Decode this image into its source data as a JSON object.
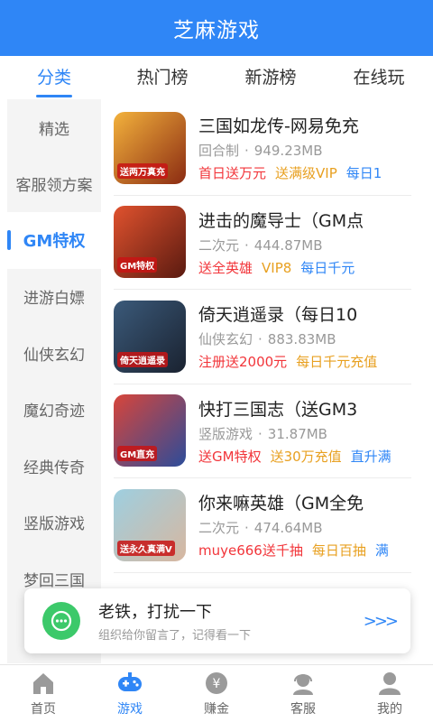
{
  "header": {
    "title": "芝麻游戏"
  },
  "tabs": [
    {
      "label": "分类",
      "active": true
    },
    {
      "label": "热门榜",
      "active": false
    },
    {
      "label": "新游榜",
      "active": false
    },
    {
      "label": "在线玩",
      "active": false
    }
  ],
  "sidebar": {
    "items": [
      {
        "label": "精选"
      },
      {
        "label": "客服领方案"
      },
      {
        "label": "GM特权",
        "active": true
      },
      {
        "label": "进游白嫖"
      },
      {
        "label": "仙侠玄幻"
      },
      {
        "label": "魔幻奇迹"
      },
      {
        "label": "经典传奇"
      },
      {
        "label": "竖版游戏"
      },
      {
        "label": "梦回三国"
      },
      {
        "label": ""
      }
    ]
  },
  "games": [
    {
      "name": "三国如龙传-网易免充",
      "type": "回合制",
      "size": "949.23MB",
      "icon_text": "送两万真充",
      "icon_colors": [
        "#f3b23c",
        "#8b2b12"
      ],
      "tags": [
        {
          "text": "首日送万元",
          "color": "red"
        },
        {
          "text": "送满级VIP",
          "color": "gold"
        },
        {
          "text": "每日1",
          "color": "blue"
        }
      ]
    },
    {
      "name": "进击的魔导士（GM点",
      "type": "二次元",
      "size": "444.87MB",
      "icon_text": "GM特权",
      "icon_colors": [
        "#e0522e",
        "#5a1a10"
      ],
      "tags": [
        {
          "text": "送全英雄",
          "color": "red"
        },
        {
          "text": "VIP8",
          "color": "gold"
        },
        {
          "text": "每日千元",
          "color": "blue"
        }
      ]
    },
    {
      "name": "倚天逍遥录（每日10",
      "type": "仙侠玄幻",
      "size": "883.83MB",
      "icon_text": "倚天逍遥录",
      "icon_colors": [
        "#3b5a7a",
        "#1a2230"
      ],
      "tags": [
        {
          "text": "注册送2000元",
          "color": "red"
        },
        {
          "text": "每日千元充值",
          "color": "gold"
        }
      ]
    },
    {
      "name": "快打三国志（送GM3",
      "type": "竖版游戏",
      "size": "31.87MB",
      "icon_text": "GM直充",
      "icon_colors": [
        "#d8453a",
        "#2c4c9a"
      ],
      "tags": [
        {
          "text": "送GM特权",
          "color": "red"
        },
        {
          "text": "送30万充值",
          "color": "gold"
        },
        {
          "text": "直升满",
          "color": "blue"
        }
      ]
    },
    {
      "name": "你来嘛英雄（GM全免",
      "type": "二次元",
      "size": "474.64MB",
      "icon_text": "送永久真满V",
      "icon_colors": [
        "#9ecfe0",
        "#d7b7a0"
      ],
      "tags": [
        {
          "text": "muye666送千抽",
          "color": "red"
        },
        {
          "text": "每日百抽",
          "color": "gold"
        },
        {
          "text": "满",
          "color": "blue"
        }
      ]
    }
  ],
  "toast": {
    "title": "老铁，打扰一下",
    "subtitle": "组织给你留言了，记得看一下",
    "arrows": ">>>",
    "icon": "chat-bubble-icon",
    "color": "#3cc96a"
  },
  "bottom_nav": [
    {
      "label": "首页",
      "icon": "home-icon"
    },
    {
      "label": "游戏",
      "icon": "gamepad-icon",
      "active": true
    },
    {
      "label": "赚金",
      "icon": "coin-icon"
    },
    {
      "label": "客服",
      "icon": "support-icon"
    },
    {
      "label": "我的",
      "icon": "user-icon"
    }
  ],
  "colors": {
    "brand": "#2f86f6",
    "red": "#f2353a",
    "gold": "#e8a020",
    "blue": "#2f86f6"
  }
}
